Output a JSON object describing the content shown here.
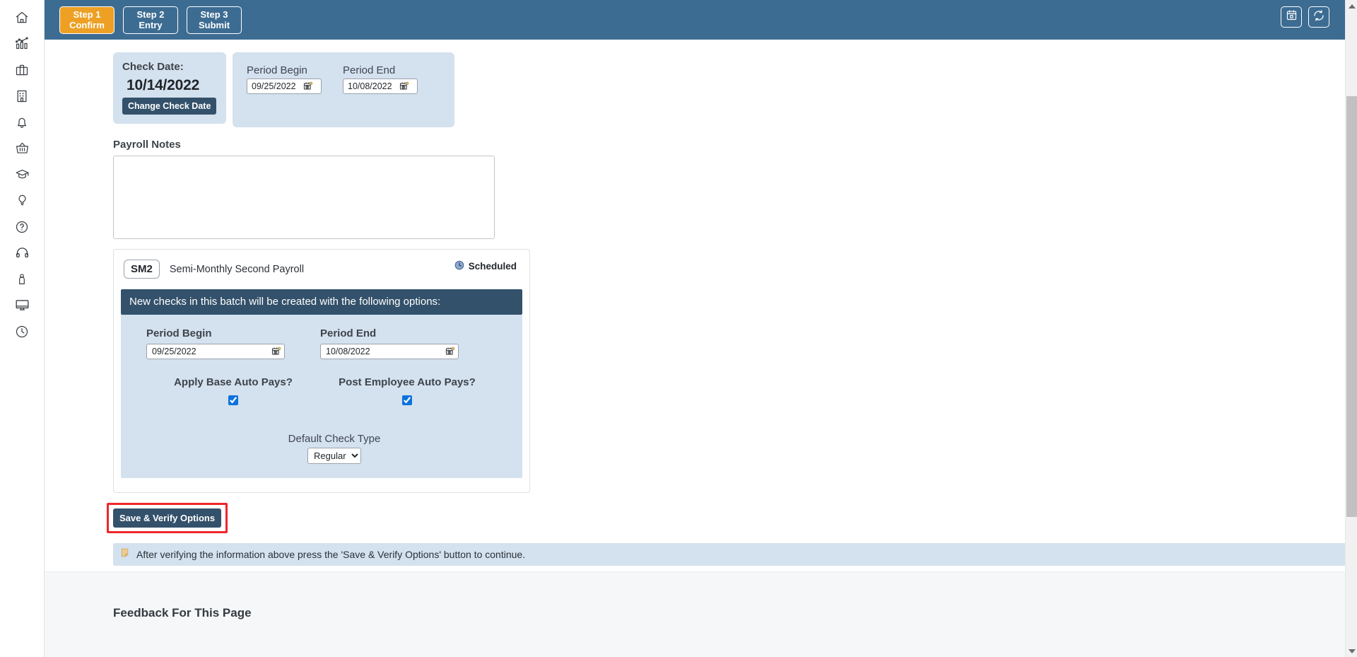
{
  "sidebar": {
    "items": [
      {
        "name": "home-icon",
        "label": "Home"
      },
      {
        "name": "analytics-chart-icon",
        "label": "Analytics"
      },
      {
        "name": "briefcase-icon",
        "label": "Briefcase"
      },
      {
        "name": "building-icon",
        "label": "Company"
      },
      {
        "name": "bell-icon",
        "label": "Notifications"
      },
      {
        "name": "basket-icon",
        "label": "Marketplace"
      },
      {
        "name": "graduation-cap-icon",
        "label": "Learning"
      },
      {
        "name": "lightbulb-icon",
        "label": "Ideas"
      },
      {
        "name": "question-circle-icon",
        "label": "Help"
      },
      {
        "name": "headset-icon",
        "label": "Support"
      },
      {
        "name": "person-icon",
        "label": "Profile"
      },
      {
        "name": "monitor-icon",
        "label": "Desktop"
      },
      {
        "name": "clock-icon",
        "label": "Time"
      }
    ]
  },
  "stepbar": {
    "steps": [
      {
        "line1": "Step 1",
        "line2": "Confirm",
        "active": true
      },
      {
        "line1": "Step 2",
        "line2": "Entry",
        "active": false
      },
      {
        "line1": "Step 3",
        "line2": "Submit",
        "active": false
      }
    ],
    "right_icons": [
      {
        "name": "calendar-icon",
        "label": "Calendar"
      },
      {
        "name": "refresh-sync-icon",
        "label": "Refresh"
      }
    ],
    "accent_active": "#eda024",
    "bar_color": "#3d6c92"
  },
  "check_panel": {
    "label": "Check Date:",
    "value": "10/14/2022",
    "change_button": "Change Check Date"
  },
  "period_panel": {
    "begin_label": "Period Begin",
    "begin_value": "09/25/2022",
    "end_label": "Period End",
    "end_value": "10/08/2022"
  },
  "notes": {
    "label": "Payroll Notes",
    "value": "",
    "placeholder": ""
  },
  "batch": {
    "code": "SM2",
    "name": "Semi-Monthly Second Payroll",
    "status": "Scheduled",
    "status_icon": "clock-icon",
    "options_header": "New checks in this batch will be created with the following options:",
    "period_begin_label": "Period Begin",
    "period_begin_value": "09/25/2022",
    "period_end_label": "Period End",
    "period_end_value": "10/08/2022",
    "apply_base_label": "Apply Base Auto Pays?",
    "apply_base_checked": true,
    "post_employee_label": "Post Employee Auto Pays?",
    "post_employee_checked": true,
    "default_check_type_label": "Default Check Type",
    "default_check_type_value": "Regular",
    "default_check_type_options": [
      "Regular"
    ]
  },
  "actions": {
    "save_verify": "Save & Verify Options",
    "highlight_color": "#f0262b"
  },
  "info": {
    "icon": "note-icon",
    "message": "After verifying the information above press the 'Save & Verify Options' button to continue."
  },
  "footer": {
    "feedback_title": "Feedback For This Page"
  }
}
